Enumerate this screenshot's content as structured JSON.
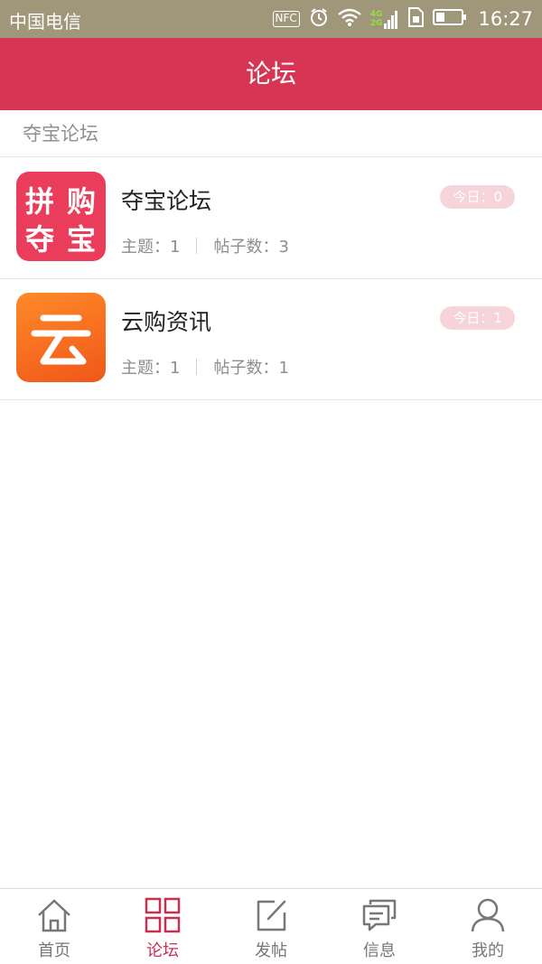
{
  "status_bar": {
    "carrier": "中国电信",
    "nfc": "NFC",
    "network_top": "4G",
    "network_bottom": "2G",
    "time": "16:27"
  },
  "header": {
    "title": "论坛"
  },
  "section": {
    "label": "夺宝论坛"
  },
  "forums": [
    {
      "name": "夺宝论坛",
      "logo_chars": [
        "拼",
        "购",
        "夺",
        "宝"
      ],
      "logo_color": "#ea3d5b",
      "topics_label": "主题：1",
      "posts_label": "帖子数：3",
      "today_label": "今日：0"
    },
    {
      "name": "云购资讯",
      "logo_icon": "cloud-character-icon",
      "logo_color": "#f36b21",
      "topics_label": "主题：1",
      "posts_label": "帖子数：1",
      "today_label": "今日：1"
    }
  ],
  "tabs": [
    {
      "label": "首页",
      "icon": "home-icon",
      "active": false
    },
    {
      "label": "论坛",
      "icon": "grid-icon",
      "active": true
    },
    {
      "label": "发帖",
      "icon": "edit-icon",
      "active": false
    },
    {
      "label": "信息",
      "icon": "message-icon",
      "active": false
    },
    {
      "label": "我的",
      "icon": "user-icon",
      "active": false
    }
  ],
  "colors": {
    "brand": "#d73554",
    "status_bar": "#a0977a",
    "active_tab": "#c8304f",
    "badge_bg": "#f7d4da"
  }
}
